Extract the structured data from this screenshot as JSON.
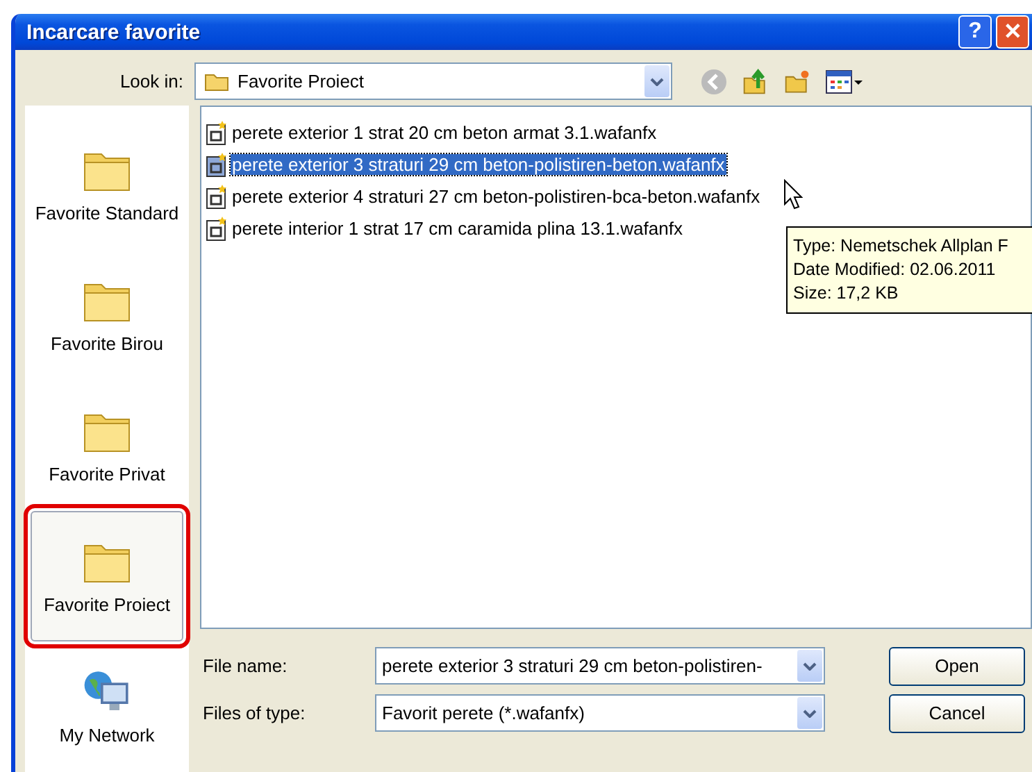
{
  "window": {
    "title": "Incarcare favorite",
    "buttons": [
      {
        "kind": "help",
        "label": "?"
      },
      {
        "kind": "close",
        "label": "✕"
      }
    ]
  },
  "look_in": {
    "label": "Look in:",
    "value": "Favorite Proiect"
  },
  "places": [
    {
      "label": "Favorite Standard",
      "kind": "folder",
      "selected": false,
      "annotated": false
    },
    {
      "label": "Favorite Birou",
      "kind": "folder",
      "selected": false,
      "annotated": false
    },
    {
      "label": "Favorite Privat",
      "kind": "folder",
      "selected": false,
      "annotated": false
    },
    {
      "label": "Favorite Proiect",
      "kind": "folder",
      "selected": true,
      "annotated": true
    },
    {
      "label": "My Network",
      "kind": "network",
      "selected": false,
      "annotated": false
    }
  ],
  "files": [
    {
      "name": "perete exterior 1 strat 20 cm beton armat 3.1.wafanfx",
      "selected": false
    },
    {
      "name": "perete exterior 3 straturi 29 cm beton-polistiren-beton.wafanfx",
      "selected": true
    },
    {
      "name": "perete exterior 4 straturi 27 cm beton-polistiren-bca-beton.wafanfx",
      "selected": false
    },
    {
      "name": "perete interior 1 strat 17 cm caramida plina 13.1.wafanfx",
      "selected": false
    }
  ],
  "tooltip": [
    "Type: Nemetschek Allplan F",
    "Date Modified: 02.06.2011",
    "Size: 17,2 KB"
  ],
  "file_name": {
    "label": "File name:",
    "value": "perete exterior 3 straturi 29 cm beton-polistiren-"
  },
  "file_type": {
    "label": "Files of type:",
    "value": "Favorit perete (*.wafanfx)"
  },
  "buttons": [
    "Open",
    "Cancel"
  ]
}
